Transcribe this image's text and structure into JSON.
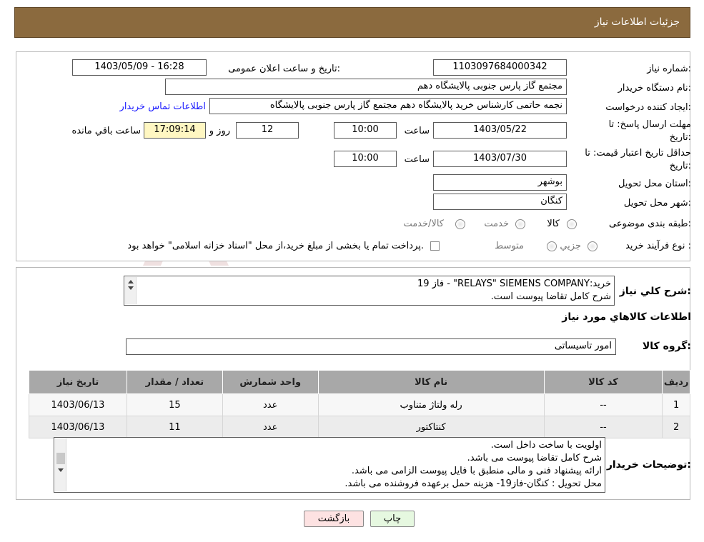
{
  "header": {
    "title": "جزئیات اطلاعات نیاز"
  },
  "watermark": {
    "text": "AriaTender.neT"
  },
  "form": {
    "need_number_label": "شماره نیاز:",
    "need_number": "1103097684000342",
    "announce_label": "تاریخ و ساعت اعلان عمومی:",
    "announce_value": "1403/05/09 - 16:28",
    "buyer_org_label": "نام دستگاه خریدار:",
    "buyer_org": "مجتمع گاز پارس جنوبی  پالایشگاه دهم",
    "creator_label": "ایجاد کننده درخواست:",
    "creator": "نجمه حاتمی کارشناس خرید پالایشگاه دهم  مجتمع گاز پارس جنوبی  پالایشگاه",
    "contact_link": "اطلاعات تماس خریدار",
    "deadline_label_1": "مهلت ارسال پاسخ: تا",
    "deadline_label_2": "تاریخ:",
    "deadline_date": "1403/05/22",
    "time_label": "ساعت",
    "deadline_time": "10:00",
    "days_value": "12",
    "days_label": "روز و",
    "remaining_time": "17:09:14",
    "remaining_label": "ساعت باقي مانده",
    "validity_label_1": "حداقل تاریخ اعتبار قیمت: تا",
    "validity_label_2": "تاریخ:",
    "validity_date": "1403/07/30",
    "validity_time": "10:00",
    "province_label": "استان محل تحویل:",
    "province": "بوشهر",
    "city_label": "شهر محل تحویل:",
    "city": "کنگان",
    "category_label": "طبقه بندی موضوعی:",
    "category_options": [
      "کالا",
      "خدمت",
      "کالا/خدمت"
    ],
    "process_label": "نوع فرآیند خرید :",
    "process_options": [
      "جزيي",
      "متوسط"
    ],
    "process_note": "پرداخت تمام یا بخشی از مبلغ خرید،از محل \"اسناد خزانه اسلامی\" خواهد بود."
  },
  "details": {
    "summary_label": "شرح کلي نياز:",
    "summary_lines": [
      "خرید:RELAYS\" SIEMENS COMPANY\" - فاز 19",
      "شرح کامل تقاضا پیوست است."
    ],
    "items_title": "اطلاعات کالاهاي مورد نياز",
    "group_label": "گروه کالا:",
    "group_value": "امور تاسیساتی",
    "table": {
      "headers": [
        "رديف",
        "کد کالا",
        "نام کالا",
        "واحد شمارش",
        "تعداد / مقدار",
        "تاریخ نیاز"
      ],
      "rows": [
        [
          "1",
          "--",
          "رله ولتاژ متناوب",
          "عدد",
          "15",
          "1403/06/13"
        ],
        [
          "2",
          "--",
          "کنتاکتور",
          "عدد",
          "11",
          "1403/06/13"
        ]
      ]
    },
    "buyer_notes_label": "توضیحات خریدار:",
    "buyer_notes_lines": [
      "اولویت با ساخت داخل است.",
      "شرح کامل تقاضا پیوست می باشد.",
      "ارائه پیشنهاد فنی و مالی منطبق با فایل پیوست الزامی می باشد.",
      "محل تحویل : کنگان-فاز19- هزینه حمل برعهده فروشنده می باشد."
    ]
  },
  "buttons": {
    "print": "چاپ",
    "back": "بازگشت"
  },
  "colors": {
    "header_bg": "#8b6a3e",
    "table_header_bg": "#a8a8a8",
    "print_bg": "#e6f8e0",
    "back_bg": "#fde2e2",
    "link": "#1a1aff"
  }
}
